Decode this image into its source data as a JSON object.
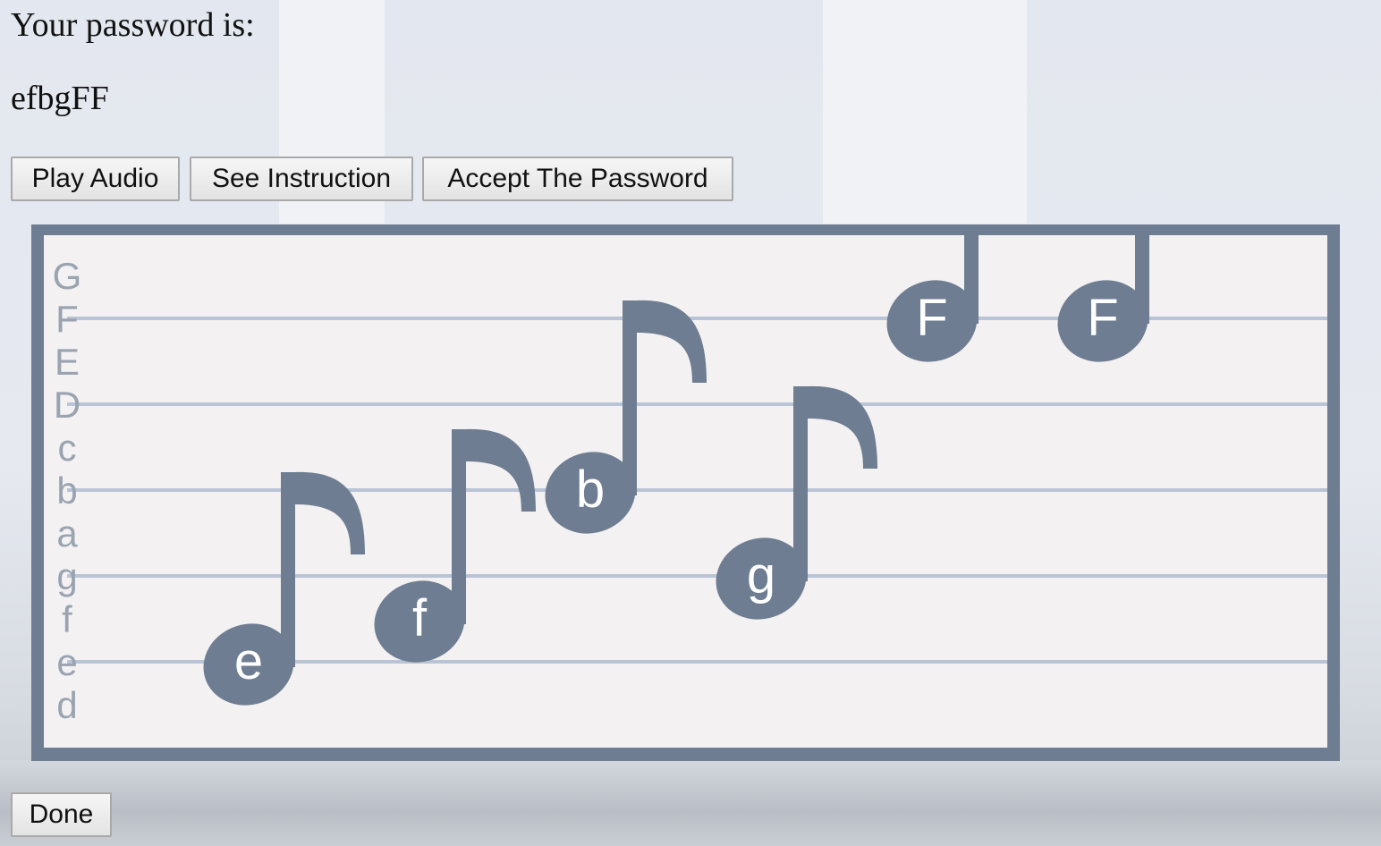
{
  "prompt": "Your password is:",
  "password": "efbgFF",
  "buttons": {
    "play_audio": "Play Audio",
    "see_instruction": "See Instruction",
    "accept_password": "Accept The Password",
    "done": "Done"
  },
  "staff": {
    "note_letters": [
      "G",
      "F",
      "E",
      "D",
      "c",
      "b",
      "a",
      "g",
      "f",
      "e",
      "d"
    ],
    "line_notes": [
      "F",
      "D",
      "b",
      "g",
      "e"
    ],
    "notes": [
      {
        "letter": "e",
        "stem": "up",
        "flag": true
      },
      {
        "letter": "f",
        "stem": "up",
        "flag": true
      },
      {
        "letter": "b",
        "stem": "up",
        "flag": true
      },
      {
        "letter": "g",
        "stem": "up",
        "flag": true
      },
      {
        "letter": "F",
        "stem": "up",
        "flag": false
      },
      {
        "letter": "F",
        "stem": "up",
        "flag": false
      }
    ],
    "colors": {
      "frame": "#6e7d91",
      "paper": "#f3f1f2",
      "line": "#b9c4d6",
      "note": "#6e7d91",
      "label": "#9aa3b0"
    }
  }
}
